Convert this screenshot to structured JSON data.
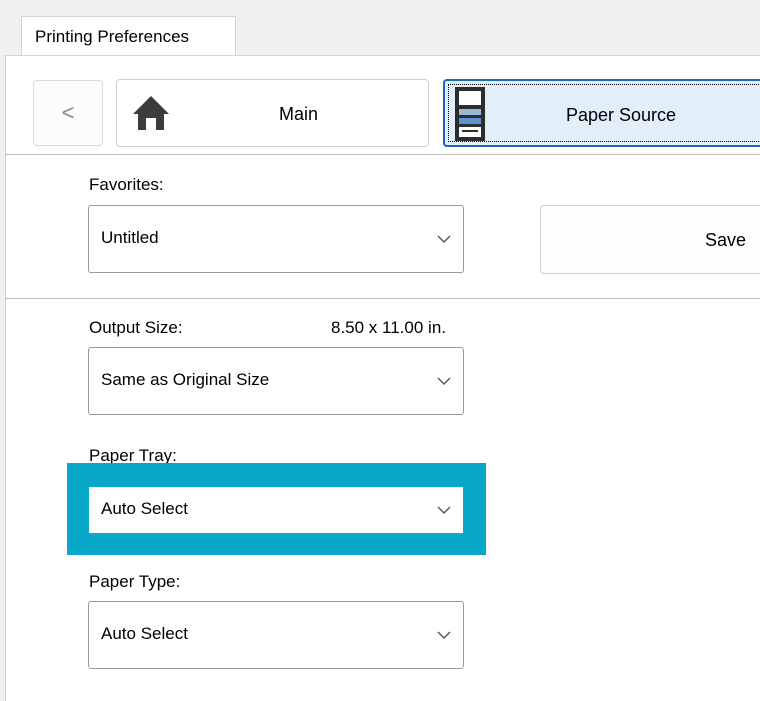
{
  "window": {
    "tab_title": "Printing Preferences"
  },
  "nav": {
    "back_label": "<",
    "main_label": "Main",
    "paper_source_label": "Paper Source"
  },
  "favorites": {
    "label": "Favorites:",
    "value": "Untitled",
    "save_label": "Save"
  },
  "output_size": {
    "label": "Output Size:",
    "dimension": "8.50 x 11.00 in.",
    "value": "Same as Original Size"
  },
  "paper_tray": {
    "label": "Paper Tray:",
    "value": "Auto Select",
    "highlight_color": "#0aa8c8"
  },
  "paper_type": {
    "label": "Paper Type:",
    "value": "Auto Select"
  },
  "colors": {
    "selected_nav_bg": "#e3eefb",
    "selected_nav_border": "#1f66b8",
    "panel_bg": "#ffffff",
    "window_bg": "#f0f0f0"
  },
  "icons": {
    "home": "home-icon",
    "paper_source": "printer-paper-icon",
    "dropdown": "chevron-down-icon"
  }
}
